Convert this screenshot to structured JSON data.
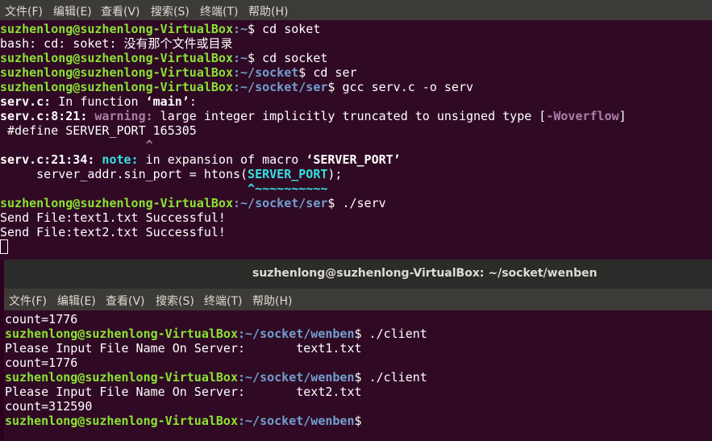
{
  "menu": [
    "文件(F)",
    "编辑(E)",
    "查看(V)",
    "搜索(S)",
    "终端(T)",
    "帮助(H)"
  ],
  "terminal1": {
    "user_host": "suzhenlong@suzhenlong-VirtualBox",
    "l1": {
      "path": ":~",
      "cmd": "$ cd soket"
    },
    "l2": "bash: cd: soket: 没有那个文件或目录",
    "l3": {
      "path": ":~",
      "cmd": "$ cd socket"
    },
    "l4": {
      "path": ":~/socket",
      "cmd": "$ cd ser"
    },
    "l5": {
      "path": ":~/socket/ser",
      "cmd": "$ gcc serv.c -o serv"
    },
    "l6": {
      "a": "serv.c:",
      "b": " In function ",
      "c": "‘main’",
      "d": ":"
    },
    "l7": {
      "loc": "serv.c:8:21:",
      "warn": " warning:",
      "msg": " large integer implicitly truncated to unsigned type [",
      "flag": "-Woverflow",
      "end": "]"
    },
    "l8": " #define SERVER_PORT 165305",
    "l9": "                    ^",
    "l10": "",
    "l11": {
      "loc": "serv.c:21:34:",
      "note": " note:",
      "msg": " in expansion of macro ",
      "macro": "‘SERVER_PORT’"
    },
    "l12": {
      "pre": "     server_addr.sin_port = htons(",
      "hl": "SERVER_PORT",
      "post": ");"
    },
    "l13": "                                  ^~~~~~~~~~~",
    "l14": {
      "path": ":~/socket/ser",
      "cmd": "$ ./serv"
    },
    "l15": "Send File:text1.txt Successful!",
    "l16": "Send File:text2.txt Successful!"
  },
  "window2": {
    "title": "suzhenlong@suzhenlong-VirtualBox: ~/socket/wenben",
    "menu": [
      "文件(F)",
      "编辑(E)",
      "查看(V)",
      "搜索(S)",
      "终端(T)",
      "帮助(H)"
    ],
    "user_host": "suzhenlong@suzhenlong-VirtualBox",
    "path": ":~/socket/wenben",
    "l1": "count=1776",
    "l2": "$ ./client",
    "l3": "Please Input File Name On Server:       text1.txt",
    "l4": "count=1776",
    "l5": "$ ./client",
    "l6": "Please Input File Name On Server:       text2.txt",
    "l7": "count=312590",
    "l8": "$"
  }
}
